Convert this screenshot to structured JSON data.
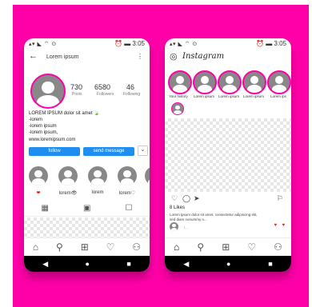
{
  "colors": {
    "background": "#ff00a8",
    "accent": "#1e8ff0",
    "avatar": "#888888"
  },
  "left_phone": {
    "status": {
      "left_icons": "▴▾ ◣ ⌔ ⊙",
      "right": "⏰ ▬ 3:05"
    },
    "header": {
      "username": "Lorem ipsum",
      "menu": "⋮"
    },
    "stats": [
      {
        "value": "730",
        "label": "Posts"
      },
      {
        "value": "6580",
        "label": "Followers"
      },
      {
        "value": "46",
        "label": "Following"
      }
    ],
    "bio": [
      "LOREM IPSUM dolor sit amet 🍃",
      "-lorem",
      "-lorem ipsum",
      "-lorem ipsum,",
      "www.loremipsum.com"
    ],
    "buttons": {
      "follow": "follow",
      "message": "send message",
      "more": "⌄"
    },
    "highlights": [
      "❤",
      "lorem👁",
      "lorem",
      "lorem♡"
    ]
  },
  "right_phone": {
    "status": {
      "left_icons": "▴▾ ◣ ⌔ ⊙",
      "right": "⏰ ▬ 3:05"
    },
    "brand": "Instagram",
    "stories": [
      "Your history",
      "Lorem ipsum",
      "Lorem ipsum",
      "Lorem ipsum",
      "Lorem ips"
    ],
    "likes": "8 Likes",
    "caption": [
      "Lorem ipsum dolor sit amet, consectetur adipiscing elit,",
      "sed diam nonummy n...",
      "t..."
    ]
  },
  "nav": {
    "back": "◀",
    "home": "●",
    "recent": "■"
  }
}
